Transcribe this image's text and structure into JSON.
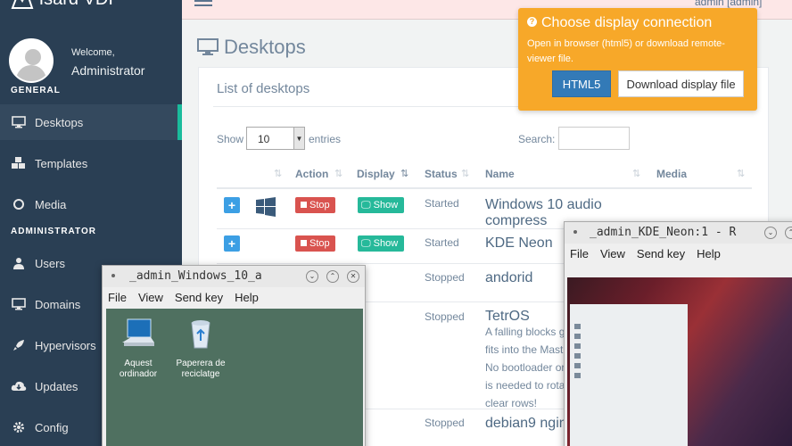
{
  "app": {
    "brand": "Isard VDI",
    "welcome": "Welcome,",
    "user_name": "Administrator",
    "top_user": "admin [admin]"
  },
  "sidebar": {
    "section_general": "GENERAL",
    "section_admin": "ADMINISTRATOR",
    "items": [
      {
        "label": "Desktops",
        "icon": "monitor-icon"
      },
      {
        "label": "Templates",
        "icon": "cubes-icon"
      },
      {
        "label": "Media",
        "icon": "circle-icon"
      },
      {
        "label": "Users",
        "icon": "user-icon"
      },
      {
        "label": "Domains",
        "icon": "monitor-icon"
      },
      {
        "label": "Hypervisors",
        "icon": "rocket-icon"
      },
      {
        "label": "Updates",
        "icon": "cloud-download-icon"
      },
      {
        "label": "Config",
        "icon": "gear-icon"
      }
    ]
  },
  "main": {
    "page_title": "Desktops",
    "panel_title": "List of desktops",
    "show_label": "Show",
    "entries_value": "10",
    "entries_label": "entries",
    "search_label": "Search:",
    "columns": [
      "Action",
      "Display",
      "Status",
      "Name",
      "Media"
    ],
    "rows": [
      {
        "action": "Stop",
        "display": "Show",
        "status": "Started",
        "name_line1": "Windows 10 audio",
        "name_line2": "compress"
      },
      {
        "action": "Stop",
        "display": "Show",
        "status": "Started",
        "name_line1": "KDE Neon"
      },
      {
        "status": "Stopped",
        "name_line1": "andorid"
      },
      {
        "status": "Stopped",
        "name_line1": "TetrOS",
        "desc": [
          "A falling blocks g",
          "fits into the Mast",
          "No bootloader or",
          "is needed to rota",
          "clear rows!"
        ]
      },
      {
        "status": "Stopped",
        "name_line1": "debian9 ngin"
      }
    ]
  },
  "popover": {
    "title": "Choose display connection",
    "body": "Open in browser (html5) or download remote-viewer file.",
    "html5_label": "HTML5",
    "download_label": "Download display file"
  },
  "viewer_windows": [
    {
      "title": "_admin_Windows_10_a",
      "menu": [
        "File",
        "View",
        "Send key",
        "Help"
      ],
      "desktop_icons": [
        {
          "line1": "Aquest",
          "line2": "ordinador",
          "icon": "computer-icon"
        },
        {
          "line1": "Paperera de",
          "line2": "reciclatge",
          "icon": "recycle-bin-icon"
        }
      ]
    },
    {
      "title": "_admin_KDE_Neon:1 - R",
      "menu": [
        "File",
        "View",
        "Send key",
        "Help"
      ]
    }
  ],
  "colors": {
    "sidebar_bg": "#2a3f54",
    "accent_green": "#1abb9c",
    "stop_red": "#d9534f",
    "show_green": "#26b99a",
    "popover_orange": "#f7a829",
    "primary_blue": "#337ab7"
  }
}
